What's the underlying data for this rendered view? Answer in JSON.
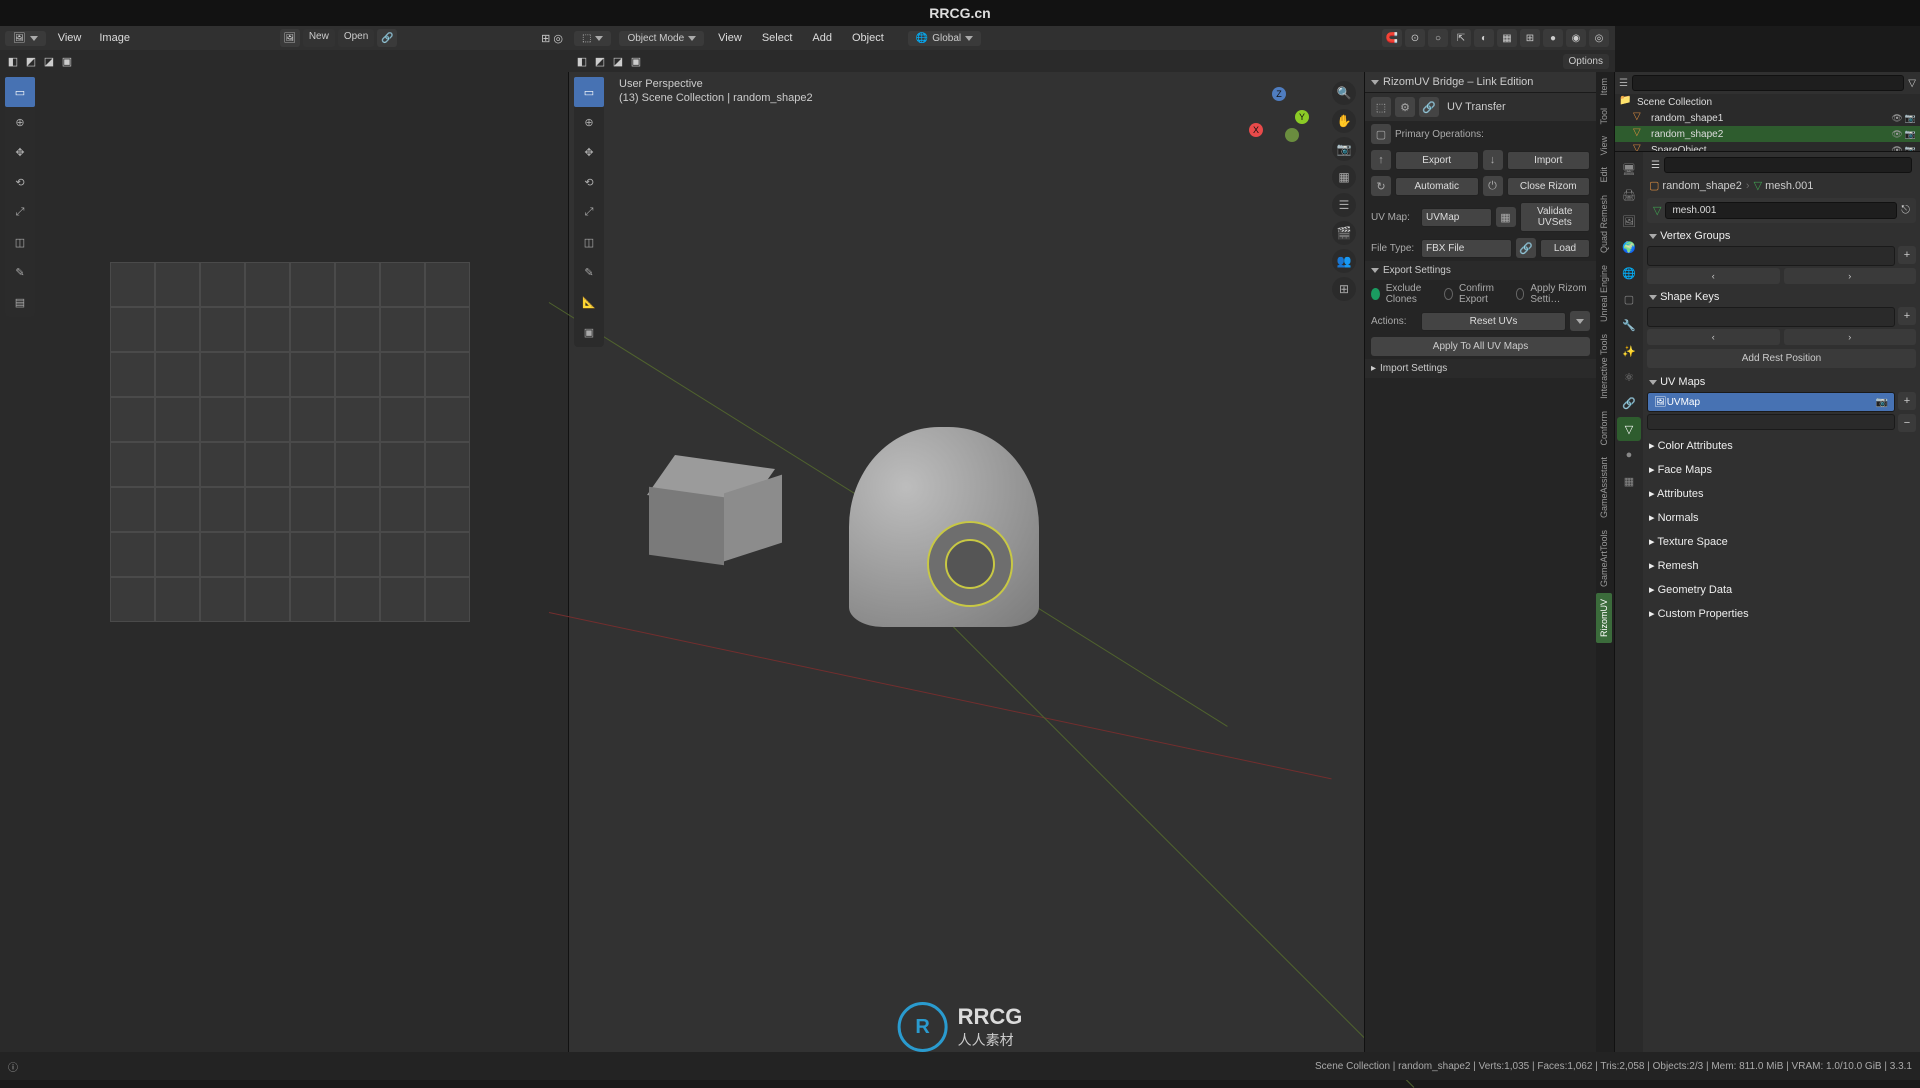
{
  "app": {
    "title": "RRCG.cn"
  },
  "uv_editor": {
    "menus": [
      "View",
      "Image"
    ],
    "filebar": {
      "new": "New",
      "open": "Open"
    }
  },
  "viewport3d": {
    "mode": "Object Mode",
    "menus": [
      "View",
      "Select",
      "Add",
      "Object"
    ],
    "orientation": "Global",
    "options": "Options",
    "overlay_line1": "User Perspective",
    "overlay_line2": "(13) Scene Collection | random_shape2",
    "axes": {
      "x": "X",
      "y": "Y",
      "z": "Z"
    }
  },
  "npanel": {
    "title": "RizomUV Bridge – Link Edition",
    "sub": "UV Transfer",
    "primary_ops": "Primary Operations:",
    "export": "Export",
    "import": "Import",
    "automatic": "Automatic",
    "close_rizom": "Close Rizom",
    "uvmap_label": "UV Map:",
    "uvmap_value": "UVMap",
    "validate": "Validate UVSets",
    "filetype_label": "File Type:",
    "filetype_value": "FBX File",
    "load": "Load",
    "export_settings": "Export Settings",
    "exclude_clones": "Exclude Clones",
    "confirm_export": "Confirm Export",
    "apply_rizom": "Apply Rizom Setti…",
    "actions_label": "Actions:",
    "actions_value": "Reset UVs",
    "apply_all": "Apply To All UV Maps",
    "import_settings": "Import Settings",
    "tabs": [
      "Item",
      "Tool",
      "View",
      "Edit",
      "Quad Remesh",
      "Unreal Engine",
      "Interactive Tools",
      "Conform",
      "GameAssistant",
      "GameArtTools",
      "RizomUV"
    ]
  },
  "outliner": {
    "root": "Scene Collection",
    "items": [
      {
        "name": "random_shape1",
        "sel": false
      },
      {
        "name": "random_shape2",
        "sel": true
      },
      {
        "name": "SpareObject",
        "sel": false
      }
    ]
  },
  "properties": {
    "search_ph": "",
    "breadcrumb": {
      "obj": "random_shape2",
      "mesh": "mesh.001"
    },
    "mesh_name": "mesh.001",
    "sections": {
      "vertex_groups": "Vertex Groups",
      "shape_keys": "Shape Keys",
      "add_rest": "Add Rest Position",
      "uv_maps": "UV Maps",
      "uv_item": "UVMap",
      "color_attributes": "Color Attributes",
      "face_maps": "Face Maps",
      "attributes": "Attributes",
      "normals": "Normals",
      "texture_space": "Texture Space",
      "remesh": "Remesh",
      "geometry_data": "Geometry Data",
      "custom_props": "Custom Properties"
    }
  },
  "status": {
    "right": "Scene Collection | random_shape2 | Verts:1,035 | Faces:1,062 | Tris:2,058 | Objects:2/3 | Mem: 811.0 MiB | VRAM: 1.0/10.0 GiB | 3.3.1"
  },
  "logo": {
    "text": "RRCG",
    "sub": "人人素材"
  }
}
